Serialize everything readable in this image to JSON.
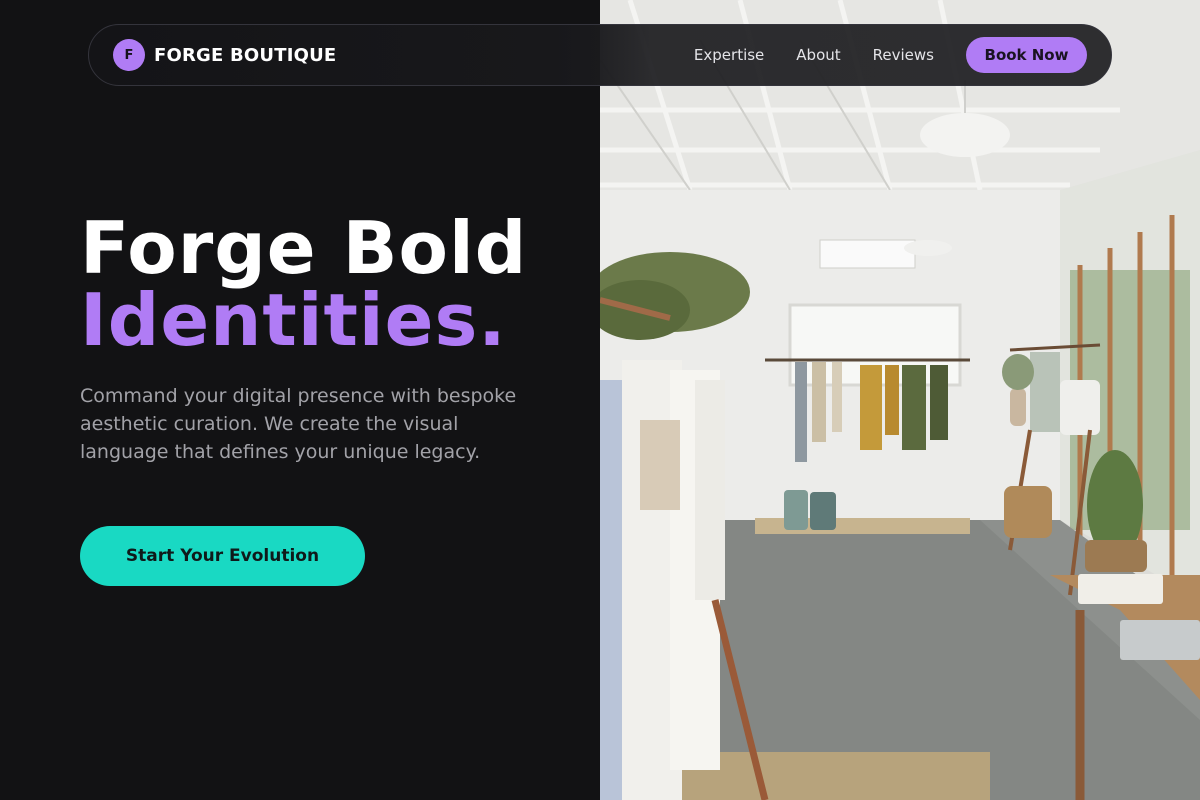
{
  "nav": {
    "logo_letter": "F",
    "brand": "FORGE BOUTIQUE",
    "links": [
      "Expertise",
      "About",
      "Reviews"
    ],
    "cta": "Book Now"
  },
  "hero": {
    "title_line1": "Forge Bold",
    "title_line2": "Identities.",
    "description": "Command your digital presence with bespoke aesthetic curation. We create the visual language that defines your unique legacy.",
    "cta": "Start Your Evolution"
  },
  "colors": {
    "background": "#121214",
    "accent_purple": "#b07cf5",
    "accent_teal": "#19d9c3"
  },
  "image": {
    "description_icon": "boutique-interior-photo"
  }
}
